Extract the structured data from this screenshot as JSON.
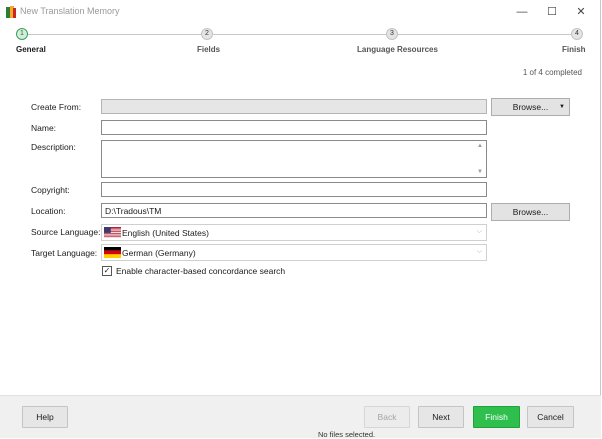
{
  "window": {
    "title": "New Translation Memory",
    "controls": {
      "minimize": "—",
      "maximize": "☐",
      "close": "✕"
    }
  },
  "stepper": {
    "steps": [
      {
        "number": "1",
        "label": "General",
        "active": true
      },
      {
        "number": "2",
        "label": "Fields",
        "active": false
      },
      {
        "number": "3",
        "label": "Language Resources",
        "active": false
      },
      {
        "number": "4",
        "label": "Finish",
        "active": false
      }
    ],
    "progress_text": "1 of 4 completed"
  },
  "form": {
    "create_from": {
      "label": "Create From:",
      "value": "",
      "button_label": "Browse...",
      "dropdown_caret": "▼"
    },
    "name": {
      "label": "Name:",
      "value": ""
    },
    "description": {
      "label": "Description:",
      "value": ""
    },
    "copyright": {
      "label": "Copyright:",
      "value": ""
    },
    "location": {
      "label": "Location:",
      "value": "D:\\Tradous\\TM",
      "button_label": "Browse..."
    },
    "source_language": {
      "label": "Source Language:",
      "value": "English (United States)",
      "flag": "us-flag-icon"
    },
    "target_language": {
      "label": "Target Language:",
      "value": "German (Germany)",
      "flag": "de-flag-icon"
    },
    "concordance": {
      "label": "Enable character-based concordance search",
      "checked": true,
      "check_glyph": "✓"
    }
  },
  "footer": {
    "help_label": "Help",
    "back_label": "Back",
    "next_label": "Next",
    "finish_label": "Finish",
    "cancel_label": "Cancel"
  },
  "background_status": "No files selected.",
  "colors": {
    "accent_green": "#2fbf4d",
    "active_step": "#3aa35c"
  }
}
